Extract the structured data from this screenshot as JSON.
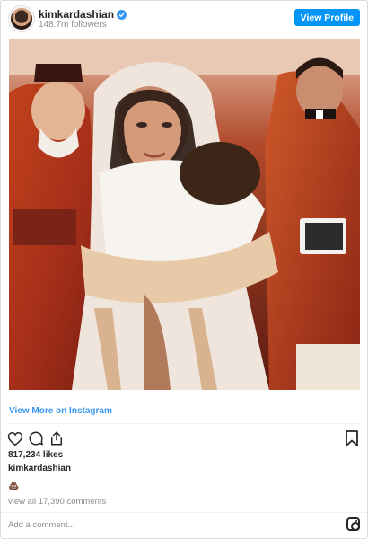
{
  "header": {
    "username": "kimkardashian",
    "followers": "148.7m followers",
    "view_profile_label": "View Profile"
  },
  "post": {
    "view_more_label": "View More on Instagram",
    "likes": "817,234 likes",
    "caption_username": "kimkardashian",
    "caption_emoji": "💩",
    "view_comments_label": "view all 17,390 comments",
    "comment_placeholder": "Add a comment..."
  },
  "icons": {
    "verified": "verified-badge-icon",
    "like": "heart-icon",
    "comment": "comment-bubble-icon",
    "share": "share-icon",
    "save": "bookmark-icon",
    "brand": "instagram-logo-icon"
  },
  "colors": {
    "accent": "#0095f6",
    "link": "#3897f0",
    "muted": "#8e8e8e"
  }
}
